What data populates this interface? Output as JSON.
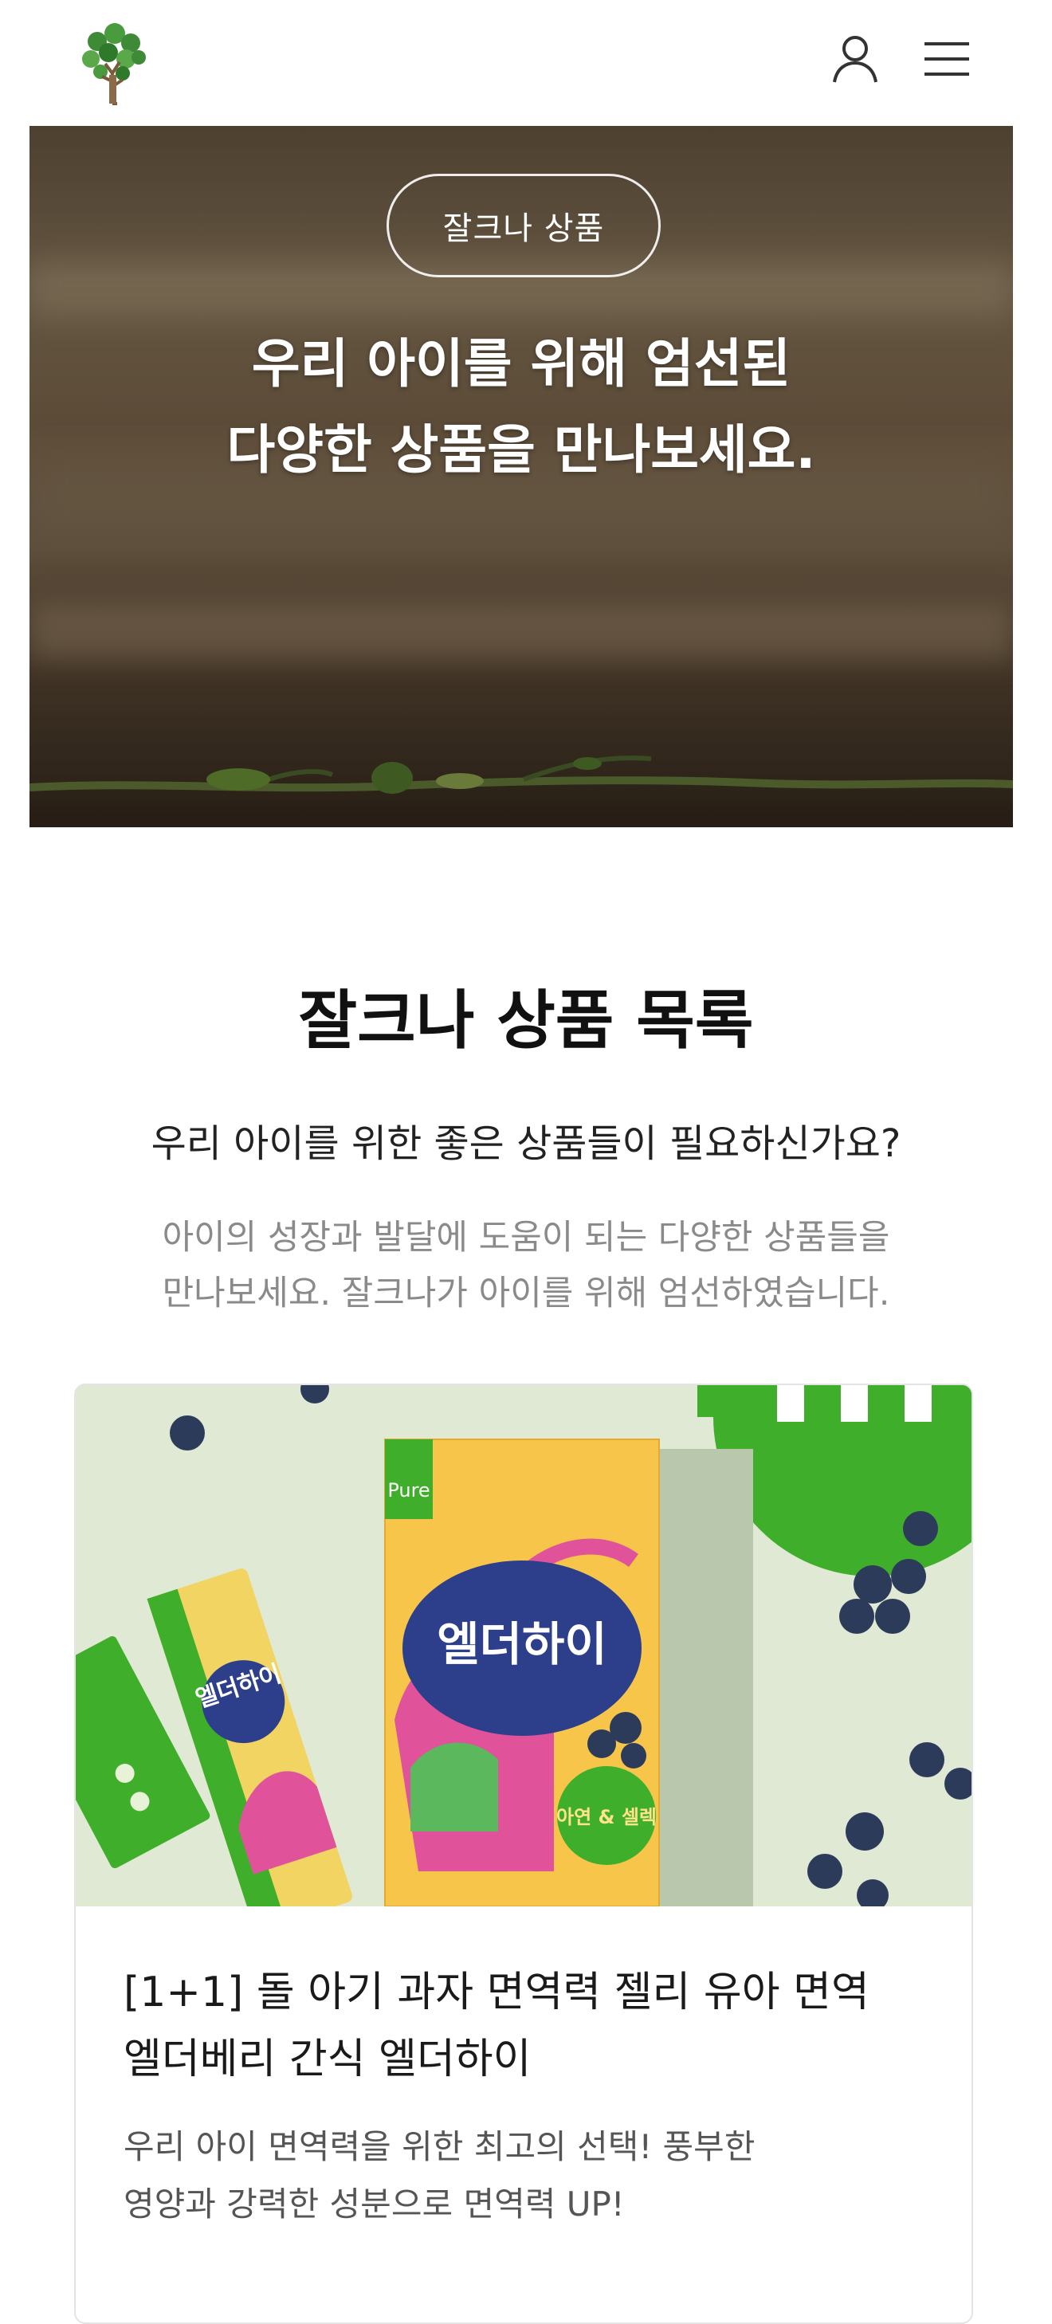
{
  "header": {
    "logo_icon": "tree-logo-icon",
    "user_icon": "user-icon",
    "menu_icon": "hamburger-menu-icon"
  },
  "hero": {
    "pill_label": "잘크나 상품",
    "title_line1": "우리 아이를 위해 엄선된",
    "title_line2": "다양한 상품을 만나보세요."
  },
  "section": {
    "title": "잘크나 상품 목록",
    "subtitle": "우리 아이를 위한 좋은 상품들이 필요하신가요?",
    "desc_line1": "아이의 성장과 발달에 도움이 되는 다양한 상품들을",
    "desc_line2": "만나보세요. 잘크나가 아이를 위해 엄선하였습니다."
  },
  "product": {
    "title_line1": "[1+1] 돌 아기 과자 면역력 젤리 유아 면역",
    "title_line2": "엘더베리 간식 엘더하이",
    "desc_line1": "우리 아이 면역력을 위한 최고의 선택! 풍부한",
    "desc_line2": "영양과 강력한 성분으로 면역력 UP!",
    "image_brand": "Pure",
    "image_product_name": "엘더하이",
    "image_stick_text": "엘더하이",
    "image_badge_text": "아연 & 셀렉"
  },
  "colors": {
    "accent_green": "#3fae2a",
    "box_yellow": "#f6c54a",
    "dino_pink": "#e0529a",
    "bg_mint": "#dfe9d4"
  }
}
